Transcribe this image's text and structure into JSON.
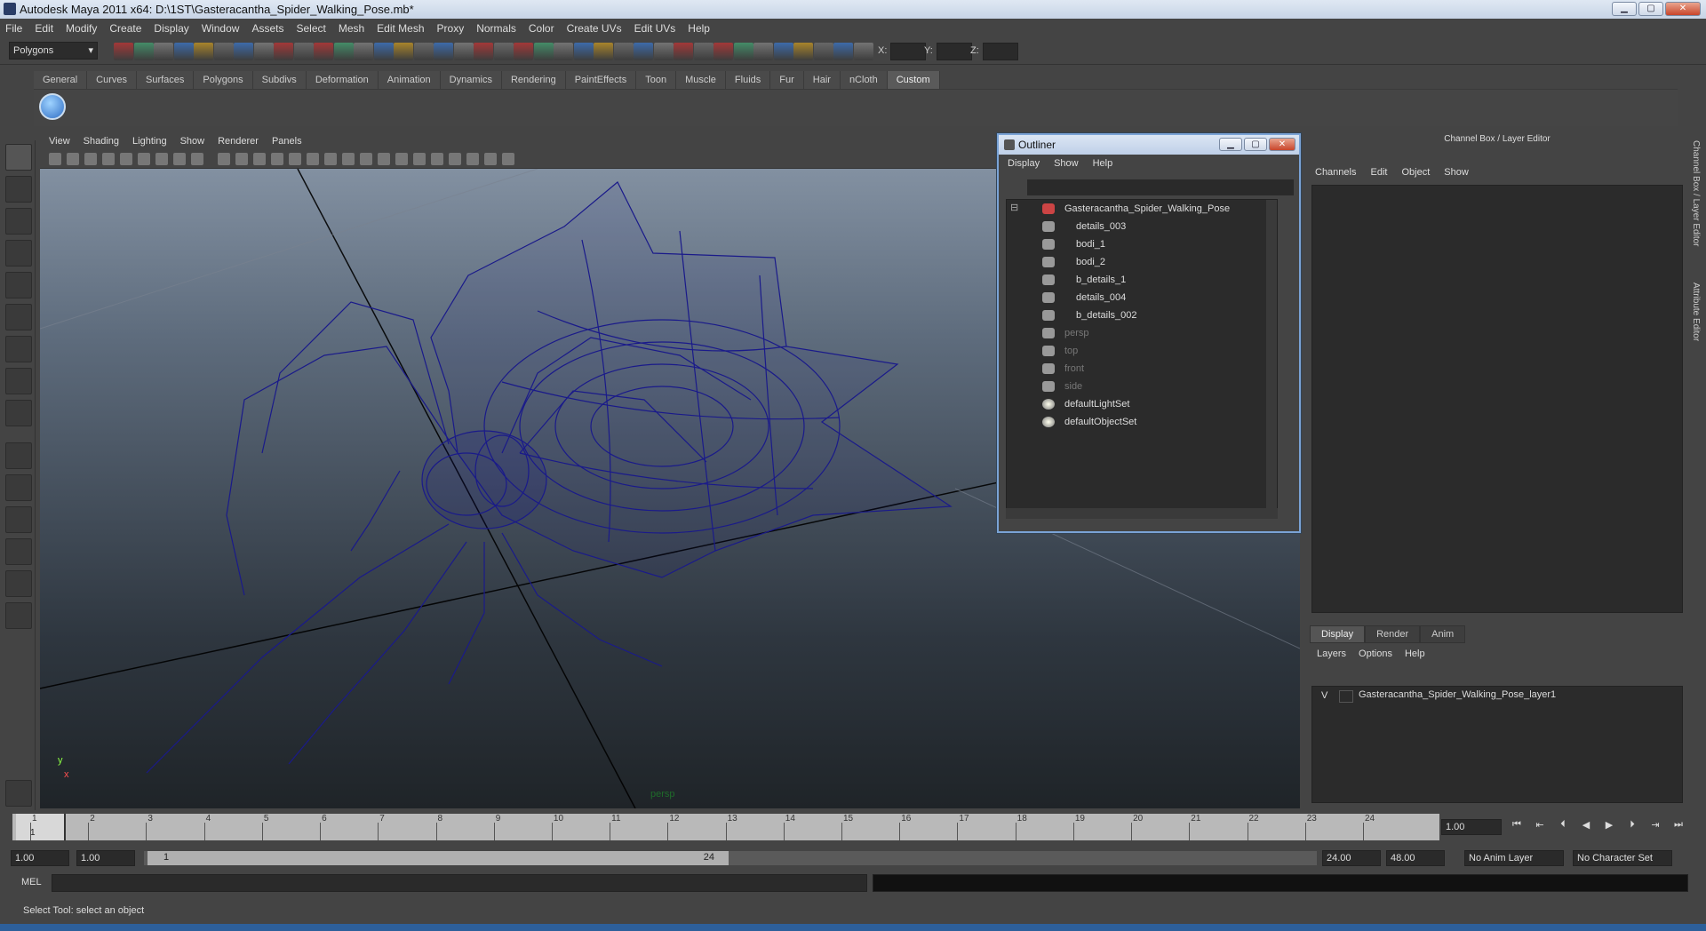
{
  "window": {
    "title": "Autodesk Maya 2011 x64: D:\\1ST\\Gasteracantha_Spider_Walking_Pose.mb*",
    "min": "▁",
    "max": "▢",
    "close": "✕"
  },
  "menubar": [
    "File",
    "Edit",
    "Modify",
    "Create",
    "Display",
    "Window",
    "Assets",
    "Select",
    "Mesh",
    "Edit Mesh",
    "Proxy",
    "Normals",
    "Color",
    "Create UVs",
    "Edit UVs",
    "Help"
  ],
  "toolbar": {
    "mode": "Polygons",
    "x_label": "X:",
    "y_label": "Y:",
    "z_label": "Z:"
  },
  "shelf_tabs": [
    "General",
    "Curves",
    "Surfaces",
    "Polygons",
    "Subdivs",
    "Deformation",
    "Animation",
    "Dynamics",
    "Rendering",
    "PaintEffects",
    "Toon",
    "Muscle",
    "Fluids",
    "Fur",
    "Hair",
    "nCloth",
    "Custom"
  ],
  "shelf_active": "Custom",
  "viewport": {
    "menu": [
      "View",
      "Shading",
      "Lighting",
      "Show",
      "Renderer",
      "Panels"
    ],
    "camera_label": "persp",
    "axis_y": "y",
    "axis_x": "x"
  },
  "outliner": {
    "title": "Outliner",
    "menu": [
      "Display",
      "Show",
      "Help"
    ],
    "items": [
      {
        "label": "Gasteracantha_Spider_Walking_Pose",
        "indent": 0,
        "dim": false,
        "kind": "group"
      },
      {
        "label": "details_003",
        "indent": 1,
        "dim": false,
        "kind": "mesh"
      },
      {
        "label": "bodi_1",
        "indent": 1,
        "dim": false,
        "kind": "mesh"
      },
      {
        "label": "bodi_2",
        "indent": 1,
        "dim": false,
        "kind": "mesh"
      },
      {
        "label": "b_details_1",
        "indent": 1,
        "dim": false,
        "kind": "mesh"
      },
      {
        "label": "details_004",
        "indent": 1,
        "dim": false,
        "kind": "mesh"
      },
      {
        "label": "b_details_002",
        "indent": 1,
        "dim": false,
        "kind": "mesh"
      },
      {
        "label": "persp",
        "indent": 0,
        "dim": true,
        "kind": "camera"
      },
      {
        "label": "top",
        "indent": 0,
        "dim": true,
        "kind": "camera"
      },
      {
        "label": "front",
        "indent": 0,
        "dim": true,
        "kind": "camera"
      },
      {
        "label": "side",
        "indent": 0,
        "dim": true,
        "kind": "camera"
      },
      {
        "label": "defaultLightSet",
        "indent": 0,
        "dim": false,
        "kind": "set"
      },
      {
        "label": "defaultObjectSet",
        "indent": 0,
        "dim": false,
        "kind": "set"
      }
    ]
  },
  "channelbox": {
    "title": "Channel Box / Layer Editor",
    "menu": [
      "Channels",
      "Edit",
      "Object",
      "Show"
    ]
  },
  "layer_editor": {
    "tabs": [
      "Display",
      "Render",
      "Anim"
    ],
    "active_tab": "Display",
    "menu": [
      "Layers",
      "Options",
      "Help"
    ],
    "layers": [
      {
        "visible": "V",
        "name": "Gasteracantha_Spider_Walking_Pose_layer1"
      }
    ]
  },
  "side_tabs": [
    "Channel Box / Layer Editor",
    "Attribute Editor"
  ],
  "timeline": {
    "frames": [
      "1",
      "2",
      "3",
      "4",
      "5",
      "6",
      "7",
      "8",
      "9",
      "10",
      "11",
      "12",
      "13",
      "14",
      "15",
      "16",
      "17",
      "18",
      "19",
      "20",
      "21",
      "22",
      "23",
      "24"
    ],
    "current_frame": "1",
    "current_field": "1.00"
  },
  "range": {
    "start_field": "1.00",
    "start_inner": "1.00",
    "slider_start": "1",
    "slider_end": "24",
    "end_inner": "24.00",
    "end_field": "48.00",
    "anim_layer": "No Anim Layer",
    "char_set": "No Character Set"
  },
  "cmdline": {
    "label": "MEL"
  },
  "helpline": {
    "text": "Select Tool: select an object"
  }
}
